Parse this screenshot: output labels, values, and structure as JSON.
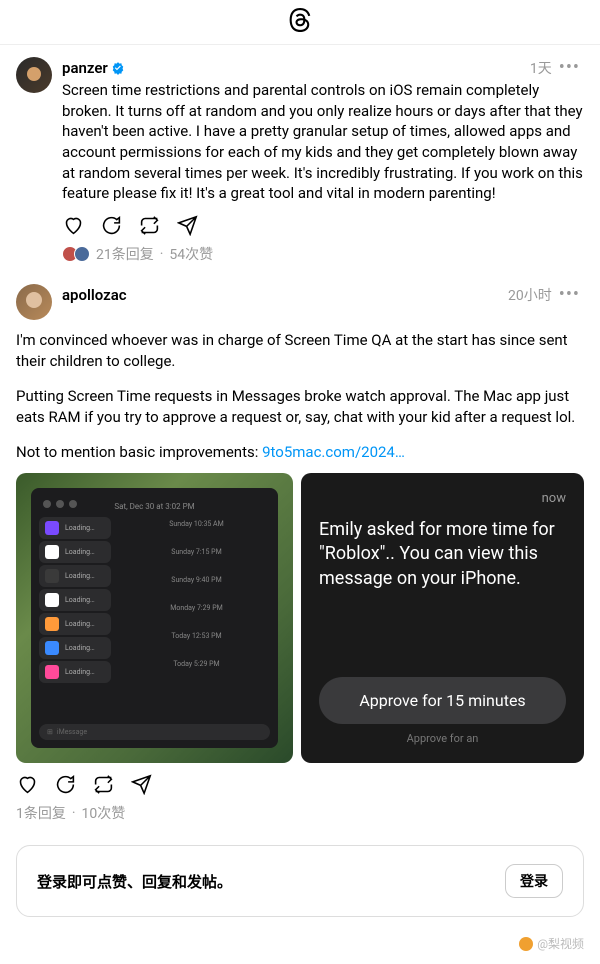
{
  "posts": [
    {
      "username": "panzer",
      "verified": true,
      "timestamp": "1天",
      "body": "Screen time restrictions and parental controls on iOS remain completely broken. It turns off at random and you only realize hours or days after that they haven't been active. I have a pretty granular setup of times, allowed apps and account permissions for each of my kids and they get completely blown away at random several times per week. It's incredibly frustrating. If you work on this feature please fix it! It's a great tool and vital in modern parenting!",
      "replies_label": "21条回复",
      "likes_label": "54次赞"
    },
    {
      "username": "apollozac",
      "timestamp": "20小时",
      "p1": "I'm convinced whoever was in charge of Screen Time QA at the start has since sent their children to college.",
      "p2": "Putting Screen Time requests in Messages broke watch approval. The Mac app just eats RAM if you try to approve a request or, say, chat with your kid after a request lol.",
      "p3_prefix": "Not to mention basic improvements: ",
      "p3_link": "9to5mac.com/2024…",
      "replies_label": "1条回复",
      "likes_label": "10次赞"
    }
  ],
  "mac": {
    "title": "Sat, Dec 30 at 3:02 PM",
    "loading": "Loading…",
    "days": [
      "Sunday 10:35 AM",
      "Sunday 7:15 PM",
      "Sunday 9:40 PM",
      "Monday 7:29 PM",
      "Today 12:53 PM",
      "Today 5:29 PM"
    ],
    "app_colors": [
      "#7a4aff",
      "#ffffff",
      "#3a3a3a",
      "#ffffff",
      "#ff9a3a",
      "#3a8aff",
      "#ff4a9a"
    ],
    "message_placeholder": "iMessage"
  },
  "watch": {
    "now": "now",
    "text": "Emily asked for more time for \"Roblox\".. You can view this message on your iPhone.",
    "approve": "Approve for 15 minutes",
    "ghost": "Approve for an"
  },
  "stats_separator": " · ",
  "login": {
    "text": "登录即可点赞、回复和发帖。",
    "button": "登录"
  },
  "watermark": "@梨视频"
}
